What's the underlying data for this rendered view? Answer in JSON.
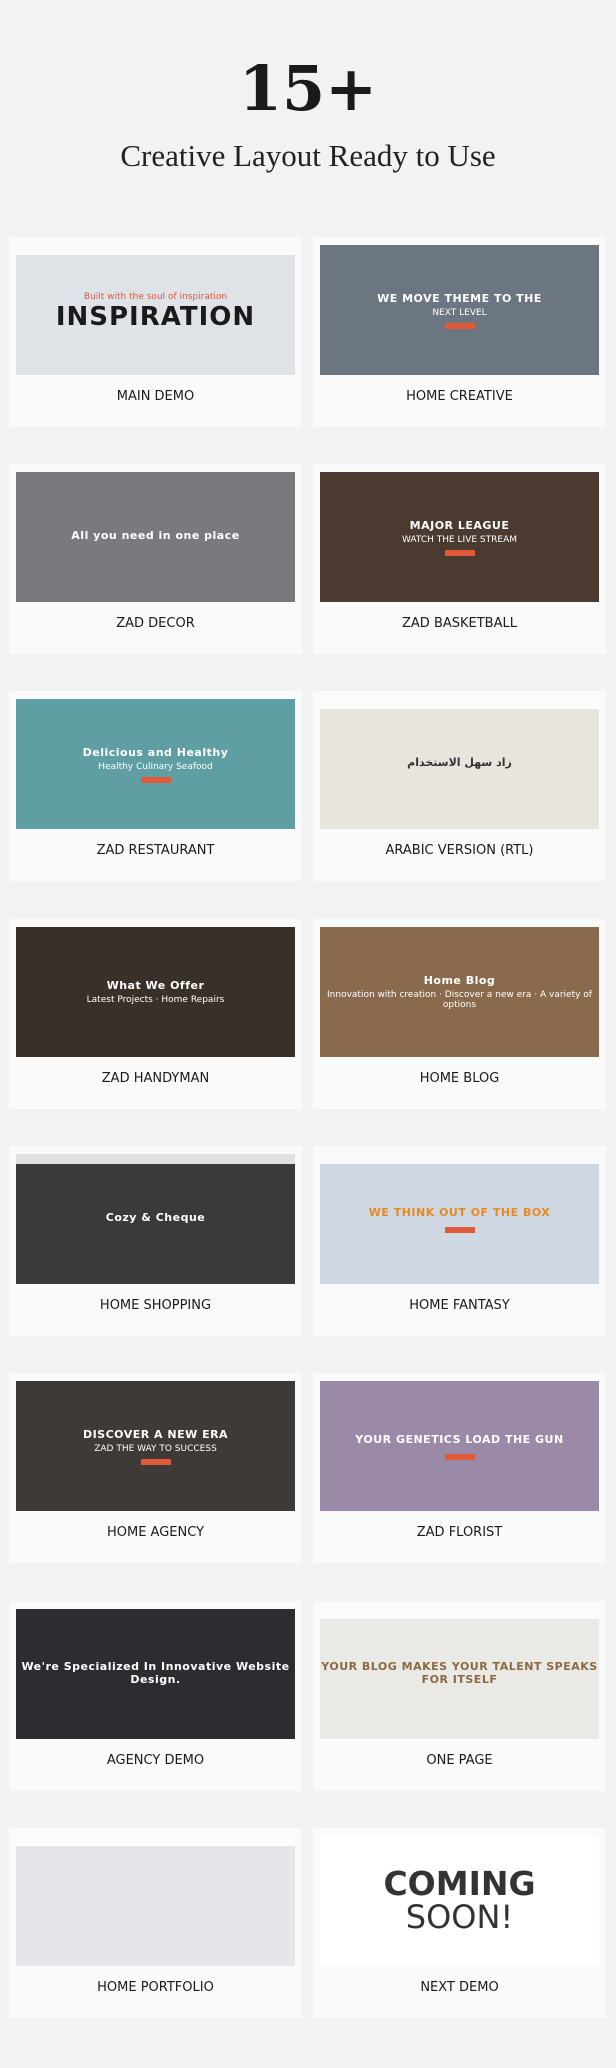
{
  "header": {
    "count": "15+",
    "subtitle": "Creative Layout Ready to Use"
  },
  "demos": [
    {
      "label": "MAIN DEMO",
      "overlay": "INSPIRATION",
      "overlay_sub": "Built with the soul of inspiration",
      "bg": "#dfe3e7",
      "fg": "#1a1a1a"
    },
    {
      "label": "HOME CREATIVE",
      "overlay": "WE MOVE THEME TO THE",
      "overlay_sub": "NEXT LEVEL",
      "bg": "#6c7680",
      "fg": "#ffffff"
    },
    {
      "label": "ZAD DECOR",
      "overlay": "All you need in one place",
      "overlay_sub": "",
      "bg": "#7a7a7e",
      "fg": "#ffffff"
    },
    {
      "label": "ZAD BASKETBALL",
      "overlay": "MAJOR LEAGUE",
      "overlay_sub": "WATCH THE LIVE STREAM",
      "bg": "#4a3a30",
      "fg": "#ffffff"
    },
    {
      "label": "ZAD RESTAURANT",
      "overlay": "Delicious and Healthy",
      "overlay_sub": "Healthy Culinary Seafood",
      "bg": "#5f9fa3",
      "fg": "#ffffff"
    },
    {
      "label": "ARABIC VERSION (RTL)",
      "overlay": "زاد سهل الاستخدام",
      "overlay_sub": "",
      "bg": "#e8e6dc",
      "fg": "#333333"
    },
    {
      "label": "ZAD HANDYMAN",
      "overlay": "What We Offer",
      "overlay_sub": "Latest Projects · Home Repairs",
      "bg": "#3a302a",
      "fg": "#ffffff"
    },
    {
      "label": "HOME BLOG",
      "overlay": "Home Blog",
      "overlay_sub": "Innovation with creation · Discover a new era · A variety of options",
      "bg": "#8a6a4c",
      "fg": "#ffffff"
    },
    {
      "label": "HOME SHOPPING",
      "overlay": "Cozy & Cheque",
      "overlay_sub": "",
      "bg": "#3a3a3a",
      "fg": "#ffffff"
    },
    {
      "label": "HOME FANTASY",
      "overlay": "WE THINK OUT OF THE BOX",
      "overlay_sub": "",
      "bg": "#cfd8e2",
      "fg": "#e8891e"
    },
    {
      "label": "HOME AGENCY",
      "overlay": "DISCOVER A NEW ERA",
      "overlay_sub": "ZAD THE WAY TO SUCCESS",
      "bg": "#3e3a38",
      "fg": "#ffffff"
    },
    {
      "label": "ZAD FLORIST",
      "overlay": "YOUR GENETICS LOAD THE GUN",
      "overlay_sub": "",
      "bg": "#9a8aa8",
      "fg": "#ffffff"
    },
    {
      "label": "AGENCY DEMO",
      "overlay": "We're Specialized In Innovative Website Design.",
      "overlay_sub": "",
      "bg": "#2c2d30",
      "fg": "#ffffff"
    },
    {
      "label": "ONE PAGE",
      "overlay": "YOUR BLOG MAKES YOUR TALENT SPEAKS FOR ITSELF",
      "overlay_sub": "",
      "bg": "#ebe9e6",
      "fg": "#8a6a40"
    },
    {
      "label": "HOME PORTFOLIO",
      "overlay": "",
      "overlay_sub": "",
      "bg": "#e4e6ea",
      "fg": "#333333"
    },
    {
      "label": "NEXT DEMO",
      "overlay": "COMING",
      "overlay_sub": "SOON!",
      "bg": "#ffffff",
      "fg": "#333333"
    }
  ]
}
